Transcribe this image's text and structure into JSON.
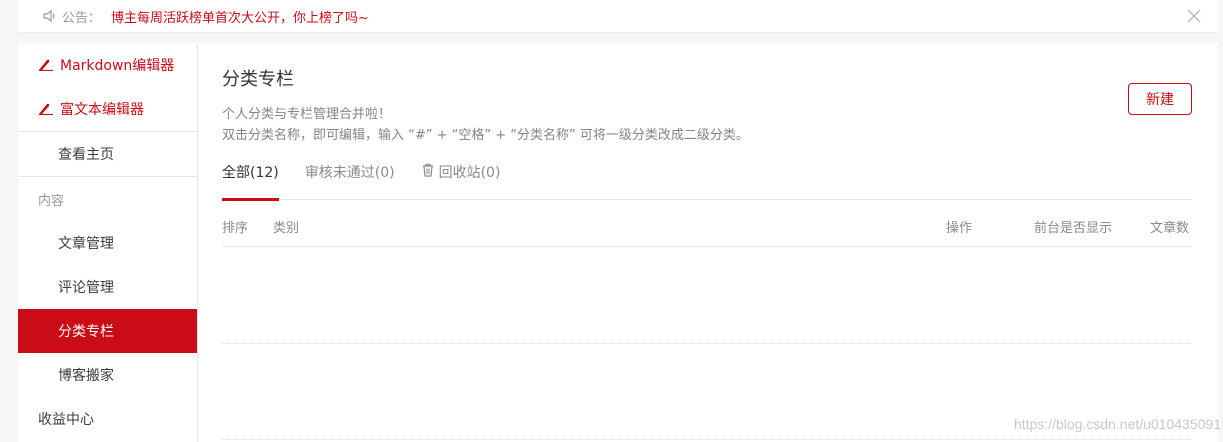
{
  "notice": {
    "label": "公告：",
    "message": "博主每周活跃榜单首次大公开，你上榜了吗~"
  },
  "sidebar": {
    "editors": [
      {
        "label": "Markdown编辑器"
      },
      {
        "label": "富文本编辑器"
      }
    ],
    "home": "查看主页",
    "group_label": "内容",
    "items": [
      {
        "label": "文章管理"
      },
      {
        "label": "评论管理"
      },
      {
        "label": "分类专栏"
      },
      {
        "label": "博客搬家"
      }
    ],
    "income": "收益中心"
  },
  "main": {
    "title": "分类专栏",
    "desc_line1": "个人分类与专栏管理合并啦！",
    "desc_line2": "双击分类名称，即可编辑，输入 “#” + “空格” + “分类名称” 可将一级分类改成二级分类。",
    "new_button": "新建",
    "tabs": [
      {
        "label": "全部(12)"
      },
      {
        "label": "审核未通过(0)"
      },
      {
        "label": "回收站(0)"
      }
    ],
    "table_headers": {
      "order": "排序",
      "category": "类别",
      "action": "操作",
      "frontend_visible": "前台是否显示",
      "article_count": "文章数"
    }
  },
  "watermark": "https://blog.csdn.net/u010435091",
  "colors": {
    "accent": "#ca0c16"
  },
  "icons": [
    "speaker-icon",
    "close-icon",
    "pen-icon",
    "trash-icon"
  ]
}
